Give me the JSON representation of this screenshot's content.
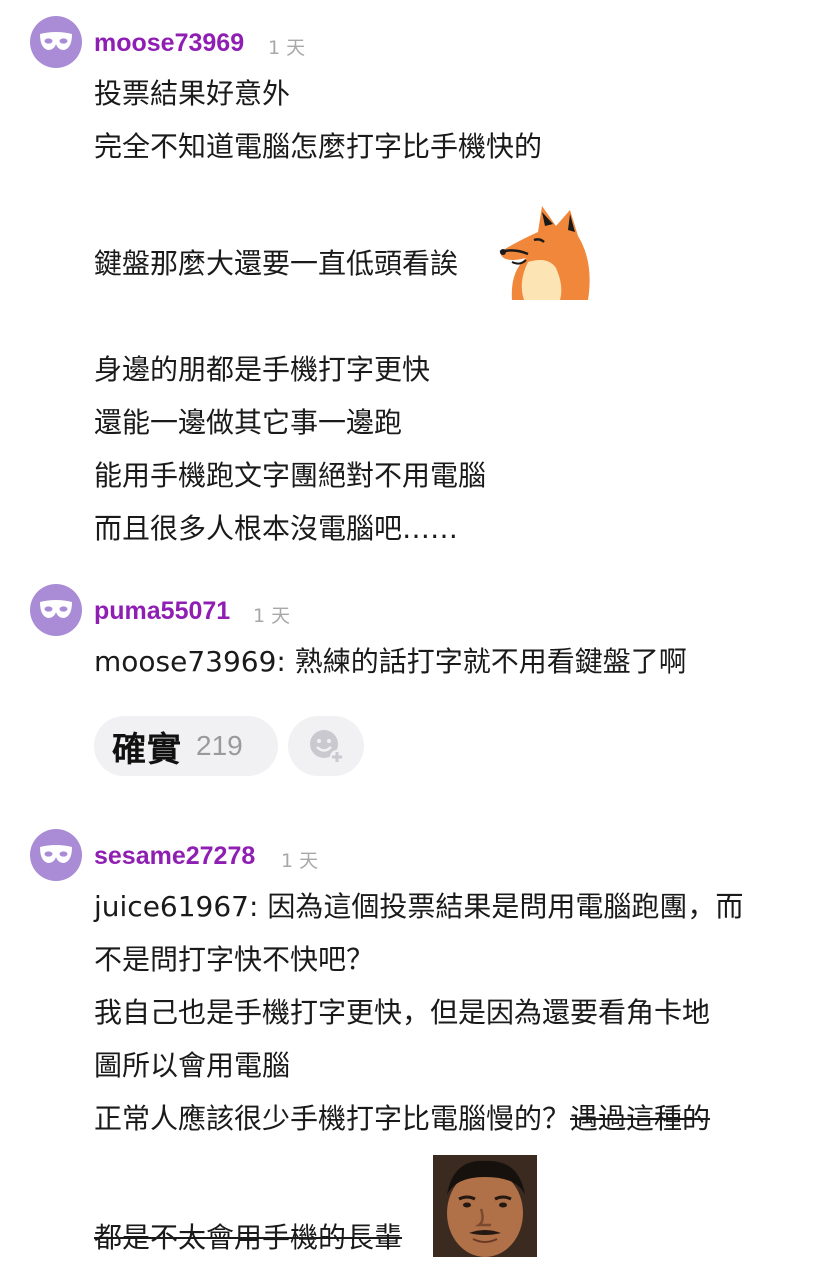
{
  "comments": [
    {
      "username": "moose73969",
      "time": "1 天",
      "avatar_icon": "mask-icon",
      "lines": [
        "投票結果好意外",
        "完全不知道電腦怎麼打字比手機快的",
        "鍵盤那麼大還要一直低頭看誒",
        "身邊的朋都是手機打字更快",
        "還能一邊做其它事一邊跑",
        "能用手機跑文字團絕對不用電腦",
        "而且很多人根本沒電腦吧……"
      ],
      "sticker_icon": "fox-sticker"
    },
    {
      "username": "puma55071",
      "time": "1 天",
      "avatar_icon": "mask-icon",
      "lines": [
        "moose73969: 熟練的話打字就不用看鍵盤了啊"
      ],
      "reactions": [
        {
          "label": "確實",
          "count": "219"
        }
      ],
      "add_reaction_icon": "add-emoji-icon"
    },
    {
      "username": "sesame27278",
      "time": "1 天",
      "avatar_icon": "mask-icon",
      "lines": [
        "juice61967: 因為這個投票結果是問用電腦跑團，而",
        "不是問打字快不快吧？",
        "我自己也是手機打字更快，但是因為還要看角卡地",
        "圖所以會用電腦",
        "正常人應該很少手機打字比電腦慢的？",
        "遇過這種的",
        "都是不太會用手機的長輩"
      ],
      "sticker_icon": "man-face-sticker"
    }
  ],
  "colors": {
    "username": "#8f1fb3",
    "avatar": "#a98bd6",
    "time": "#a8a8a8"
  }
}
